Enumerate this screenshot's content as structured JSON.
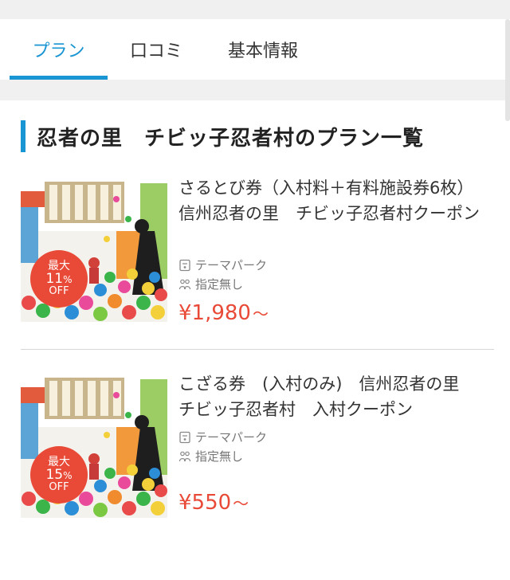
{
  "tabs": [
    {
      "label": "プラン",
      "active": true
    },
    {
      "label": "口コミ",
      "active": false
    },
    {
      "label": "基本情報",
      "active": false
    }
  ],
  "section": {
    "title": "忍者の里　チビッ子忍者村のプラン一覧"
  },
  "plans": [
    {
      "title": "さるとび券（入村料＋有料施設券6枚）信州忍者の里　チビッ子忍者村クーポン",
      "category": "テーマパーク",
      "target": "指定無し",
      "price": "¥1,980",
      "price_suffix": "〜",
      "badge": {
        "top": "最大",
        "pct": "11",
        "pct_sign": "%",
        "bottom": "OFF"
      }
    },
    {
      "title": "こざる券　(入村のみ)　信州忍者の里　チビッ子忍者村　入村クーポン",
      "category": "テーマパーク",
      "target": "指定無し",
      "price": "¥550",
      "price_suffix": "〜",
      "badge": {
        "top": "最大",
        "pct": "15",
        "pct_sign": "%",
        "bottom": "OFF"
      }
    }
  ],
  "icons": {
    "category": "ticket-icon",
    "target": "people-icon"
  },
  "colors": {
    "accent": "#1a95d3",
    "price": "#e84a37",
    "badge": "#e84a37"
  }
}
